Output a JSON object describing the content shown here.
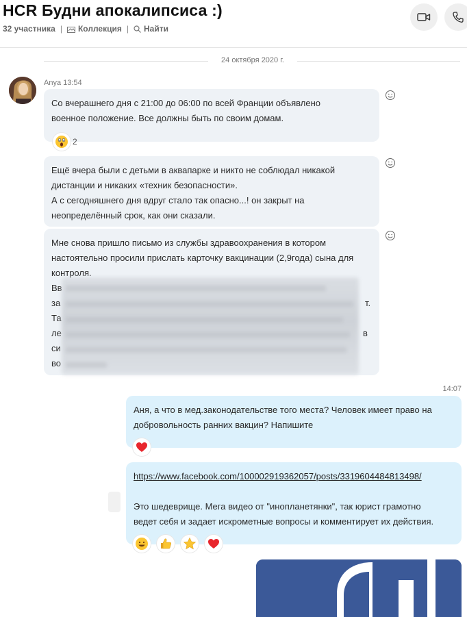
{
  "header": {
    "title": "HCR Будни апокалипсиса :)",
    "participants": "32 участника",
    "collection": "Коллекция",
    "find": "Найти"
  },
  "date_separator": "24 октября 2020 г.",
  "messages": {
    "m1": {
      "sender": "Anya 13:54",
      "line1": "Со вчерашнего дня с 21:00 до 06:00  по всей Франции объявлено",
      "line2": "военное положение. Все должны быть по своим домам.",
      "reaction_count": "2"
    },
    "m2": {
      "line1": "Ещё вчера были с детьми в аквапарке и никто не соблюдал никакой",
      "line2": "дистанции и никаких «техник безопасности».",
      "line3": "А с сегодняшнего дня вдруг стало так опасно...! он закрыт на",
      "line4": "неопределённый срок, как они сказали."
    },
    "m3": {
      "line1": "Мне снова пришло письмо из службы здравоохранения в котором",
      "line2": "настоятельно просили прислать карточку вакцинации (2,9года) сына для",
      "line3": "контроля.",
      "frag1": "Вв",
      "frag2": "за",
      "frag2_end": "т.",
      "frag3": "Та",
      "frag4": "ле",
      "frag4_end": "в",
      "frag5": "си",
      "frag6": "во"
    },
    "outgoing_time": "14:07",
    "m4": {
      "line1": "Аня, а что в мед.законодательстве того места? Человек имеет право на",
      "line2": "добровольность ранних вакцин? Напишите"
    },
    "m5": {
      "link": "https://www.facebook.com/100002919362057/posts/3319604484813498/",
      "line1": "Это шедеврище. Мега видео от \"инопланетянки\", так юрист грамотно",
      "line2": "ведет себя и задает искрометные вопросы и комментирует их действия."
    }
  },
  "colors": {
    "incoming_bubble": "#eef2f6",
    "outgoing_bubble": "#dcf1fc",
    "heart": "#e8262d",
    "facebook_blue": "#3b5998"
  }
}
